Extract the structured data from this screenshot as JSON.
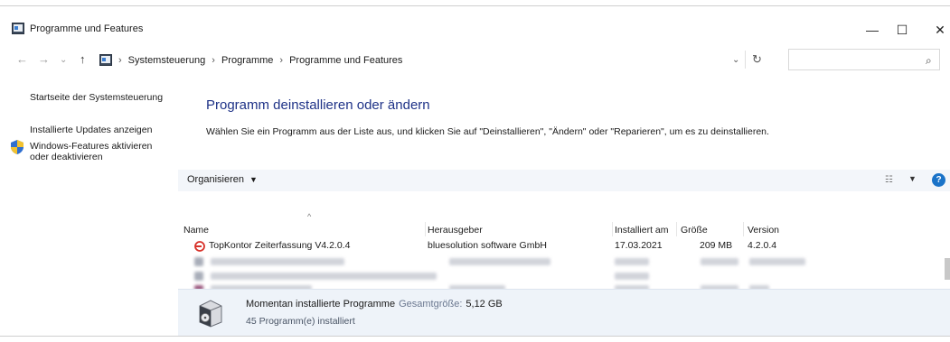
{
  "window": {
    "title": "Programme und Features",
    "minimize": "—",
    "maximize": "☐",
    "close": "✕"
  },
  "address": {
    "back": "←",
    "forward": "→",
    "recent": "⌄",
    "up": "↑",
    "crumbs": [
      "Systemsteuerung",
      "Programme",
      "Programme und Features"
    ],
    "separator": "›",
    "dropdown": "⌄",
    "refresh": "↻",
    "search_value": "",
    "search_icon": "⌕"
  },
  "sidebar": {
    "home": "Startseite der Systemsteuerung",
    "updates": "Installierte Updates anzeigen",
    "features_line1": "Windows-Features aktivieren",
    "features_line2": "oder deaktivieren"
  },
  "main": {
    "title": "Programm deinstallieren oder ändern",
    "description": "Wählen Sie ein Programm aus der Liste aus, und klicken Sie auf \"Deinstallieren\", \"Ändern\" oder \"Reparieren\", um es zu deinstallieren."
  },
  "toolbar": {
    "organize": "Organisieren",
    "organize_caret": "▼",
    "view_icon": "☷",
    "view_caret": "▼",
    "help": "?"
  },
  "columns": {
    "name": "Name",
    "publisher": "Herausgeber",
    "installed_on": "Installiert am",
    "size": "Größe",
    "version": "Version",
    "sort_indicator": "^"
  },
  "programs": [
    {
      "name": "TopKontor Zeiterfassung V4.2.0.4",
      "publisher": "bluesolution software GmbH",
      "installed_on": "17.03.2021",
      "size": "209 MB",
      "version": "4.2.0.4",
      "icon_color": "#d8322a"
    }
  ],
  "details": {
    "title": "Momentan installierte Programme",
    "size_label": "Gesamtgröße:",
    "size_value": "5,12 GB",
    "count": "45 Programm(e) installiert"
  },
  "colors": {
    "title_blue": "#1e3287",
    "toolbar_bg": "#f3f6fa",
    "details_bg": "#eef3f9",
    "help_blue": "#1a73c8"
  }
}
